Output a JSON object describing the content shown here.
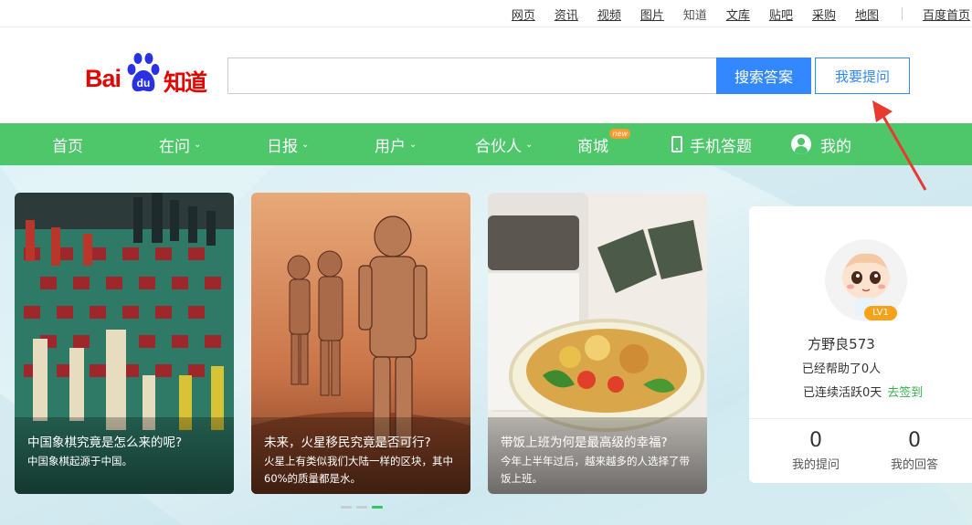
{
  "top_links": [
    {
      "label": "网页",
      "underlined": true
    },
    {
      "label": "资讯",
      "underlined": true
    },
    {
      "label": "视频",
      "underlined": true
    },
    {
      "label": "图片",
      "underlined": true
    },
    {
      "label": "知道",
      "underlined": false
    },
    {
      "label": "文库",
      "underlined": true
    },
    {
      "label": "贴吧",
      "underlined": true
    },
    {
      "label": "采购",
      "underlined": true
    },
    {
      "label": "地图",
      "underlined": true
    }
  ],
  "top_home_label": "百度首页",
  "logo": {
    "bai": "Bai",
    "du": "du",
    "zhidao": "知道"
  },
  "search": {
    "value": "",
    "placeholder": "",
    "button_label": "搜索答案"
  },
  "ask_button_label": "我要提问",
  "green_nav": {
    "home": "首页",
    "zaiwen": "在问",
    "ribao": "日报",
    "yonghu": "用户",
    "hehuoren": "合伙人",
    "shangcheng": "商城",
    "new_badge": "new",
    "shouji": "手机答题",
    "wode": "我的"
  },
  "cards": [
    {
      "title": "中国象棋究竟是怎么来的呢?",
      "desc": "中国象棋起源于中国。"
    },
    {
      "title": "未来，火星移民究竟是否可行?",
      "desc": "火星上有类似我们大陆一样的区块，其中60%的质量都是水。"
    },
    {
      "title": "带饭上班为何是最高级的幸福?",
      "desc": "今年上半年过后，越来越多的人选择了带饭上班。"
    }
  ],
  "carousel": {
    "count": 3,
    "active_index": 2
  },
  "profile": {
    "level": "LV1",
    "username": "方野良573",
    "helped": "已经帮助了0人",
    "active_days": "已连续活跃0天",
    "checkin": "去签到",
    "questions_count": "0",
    "questions_label": "我的提问",
    "answers_count": "0",
    "answers_label": "我的回答"
  },
  "colors": {
    "brand_red": "#e10601",
    "brand_blue": "#2932e1",
    "search_blue": "#3388ff",
    "nav_green": "#4ec76a",
    "annotation_red": "#e83a2e"
  }
}
